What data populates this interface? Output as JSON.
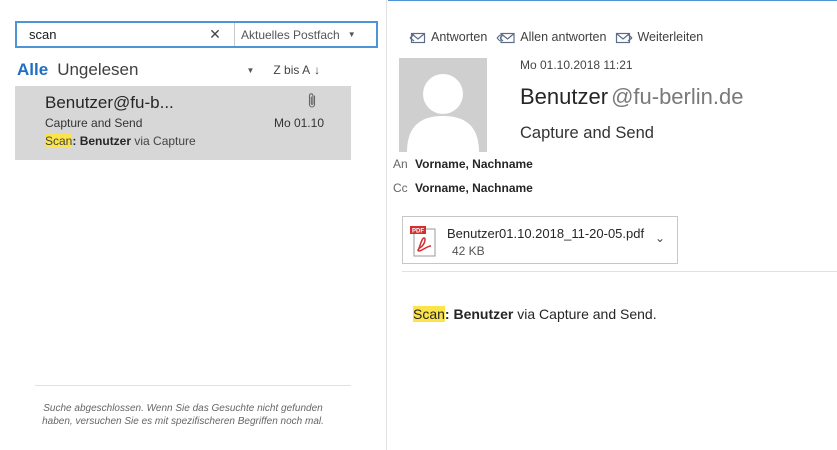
{
  "search": {
    "value": "scan",
    "clear_icon": "close-icon",
    "scope_label": "Aktuelles Postfach"
  },
  "filters": {
    "all": "Alle",
    "unread": "Ungelesen",
    "sort_label": "Z bis A",
    "sort_arrow": "↓"
  },
  "mail_list": [
    {
      "sender": "Benutzer@fu-b...",
      "subject": "Capture and Send",
      "date": "Mo 01.10",
      "preview_highlight": "Scan",
      "preview_bold": ": Benutzer",
      "preview_rest": " via Capture",
      "has_attachment": true
    }
  ],
  "search_status": "Suche abgeschlossen. Wenn Sie das Gesuchte nicht gefunden haben, versuchen Sie es mit spezifischeren Begriffen noch mal.",
  "reading": {
    "actions": {
      "reply": "Antworten",
      "reply_all": "Allen antworten",
      "forward": "Weiterleiten"
    },
    "sent_date": "Mo 01.10.2018 11:21",
    "from_name": "Benutzer",
    "from_domain": "@fu-berlin.de",
    "subject": "Capture and Send",
    "to_label": "An",
    "to_value": "Vorname, Nachname",
    "cc_label": "Cc",
    "cc_value": "Vorname, Nachname",
    "attachment": {
      "name": "Benutzer01.10.2018_11-20-05.pdf",
      "size": "42 KB",
      "icon": "pdf-icon"
    },
    "body": {
      "highlight": "Scan",
      "bold": ": Benutzer",
      "rest": " via Capture and Send."
    }
  },
  "colors": {
    "accent": "#1f6ec3",
    "search_border": "#4f94d6",
    "selected_item": "#d7d7d7",
    "highlight": "#fbe34a",
    "pdf_red": "#d32f2f"
  }
}
